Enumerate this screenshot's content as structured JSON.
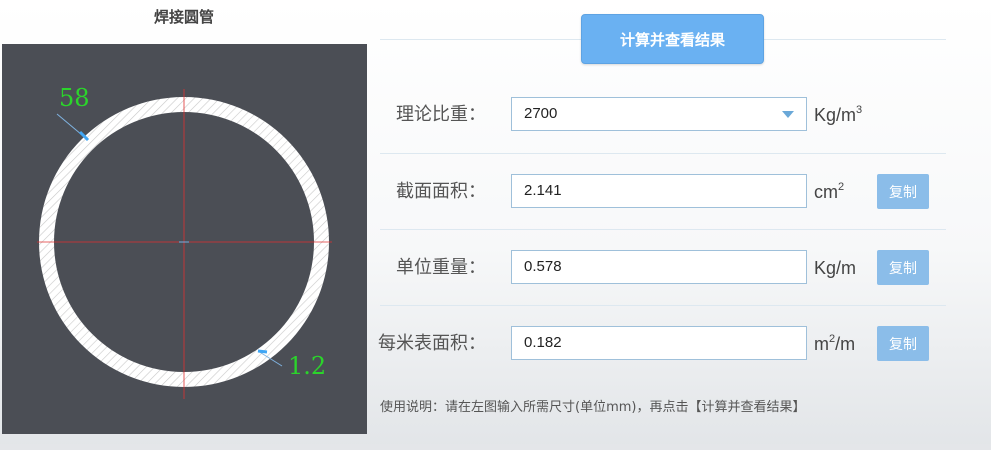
{
  "left_panel": {
    "title": "焊接圆管",
    "dim_outer_diameter": "58",
    "dim_wall_thickness": "1.2",
    "colors": {
      "canvas_bg": "#4b4e55",
      "dim_text": "#2bd42b",
      "ring_fill": "#ffffff",
      "center_lines": "#e03030"
    }
  },
  "calc_button_label": "计算并查看结果",
  "rows": [
    {
      "label": "理论比重：",
      "value": "2700",
      "unit_base": "Kg/m",
      "unit_sup": "3",
      "unit_tail": "",
      "has_copy": false,
      "is_select": true
    },
    {
      "label": "截面面积：",
      "value": "2.141",
      "unit_base": "cm",
      "unit_sup": "2",
      "unit_tail": "",
      "has_copy": true,
      "copy_label": "复制"
    },
    {
      "label": "单位重量：",
      "value": "0.578",
      "unit_base": "Kg/m",
      "unit_sup": "",
      "unit_tail": "",
      "has_copy": true,
      "copy_label": "复制"
    },
    {
      "label": "每米表面积：",
      "value": "0.182",
      "unit_base": "m",
      "unit_sup": "2",
      "unit_tail": "/m",
      "has_copy": true,
      "copy_label": "复制"
    }
  ],
  "instructions": "使用说明：请在左图输入所需尺寸(单位mm)，再点击【计算并查看结果】",
  "accent_color": "#6ab1f2"
}
